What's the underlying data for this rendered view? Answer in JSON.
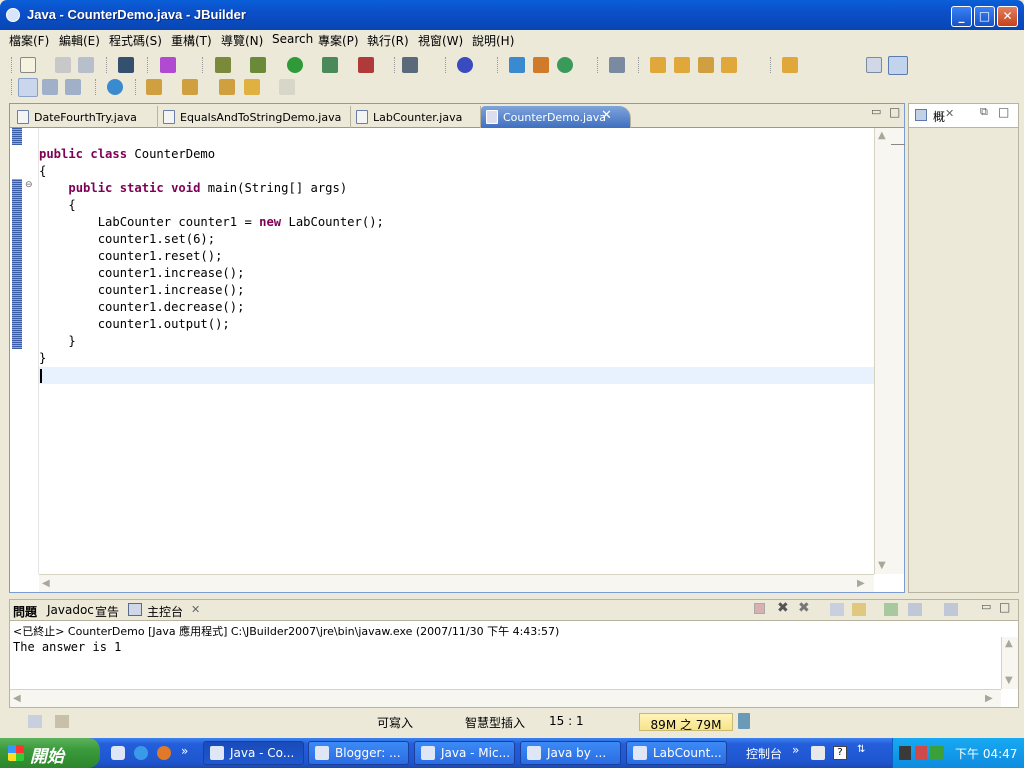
{
  "window": {
    "title": "Java - CounterDemo.java - JBuilder"
  },
  "menu": [
    "檔案(F)",
    "編輯(E)",
    "程式碼(S)",
    "重構(T)",
    "導覽(N)",
    "Search",
    "專案(P)",
    "執行(R)",
    "視窗(W)",
    "說明(H)"
  ],
  "editor": {
    "tabs": [
      "DateFourthTry.java",
      "EqualsAndToStringDemo.java",
      "LabCounter.java",
      "CounterDemo.java"
    ],
    "active_tab": "CounterDemo.java",
    "lines": [
      {
        "kw1": "public class",
        "rest": " CounterDemo"
      },
      {
        "rest": "{"
      },
      {
        "indent": "    ",
        "kw1": "public static void",
        "rest": " main(String[] args)"
      },
      {
        "rest": "    {"
      },
      {
        "pre": "        LabCounter counter1 = ",
        "kw1": "new",
        "rest": " LabCounter();"
      },
      {
        "rest": "        counter1.set(6);"
      },
      {
        "rest": "        counter1.reset();"
      },
      {
        "rest": "        counter1.increase();"
      },
      {
        "rest": "        counter1.increase();"
      },
      {
        "rest": "        counter1.decrease();"
      },
      {
        "rest": "        counter1.output();"
      },
      {
        "rest": "    }"
      },
      {
        "rest": "}"
      }
    ]
  },
  "outline": {
    "tab": "概"
  },
  "console": {
    "tabs": [
      "問題",
      "Javadoc",
      "宣告",
      "主控台"
    ],
    "header": "<已終止> CounterDemo [Java 應用程式] C:\\JBuilder2007\\jre\\bin\\javaw.exe (2007/11/30 下午 4:43:57)",
    "output": "The answer is 1"
  },
  "status": {
    "writable": "可寫入",
    "insert_mode": "智慧型插入",
    "position": "15 : 1",
    "memory": "89M 之 79M"
  },
  "taskbar": {
    "start": "開始",
    "buttons": [
      "Java - Co...",
      "Blogger: ...",
      "Java - Mic...",
      "Java by ...",
      "LabCount..."
    ],
    "quick": "控制台",
    "clock": "下午 04:47"
  }
}
